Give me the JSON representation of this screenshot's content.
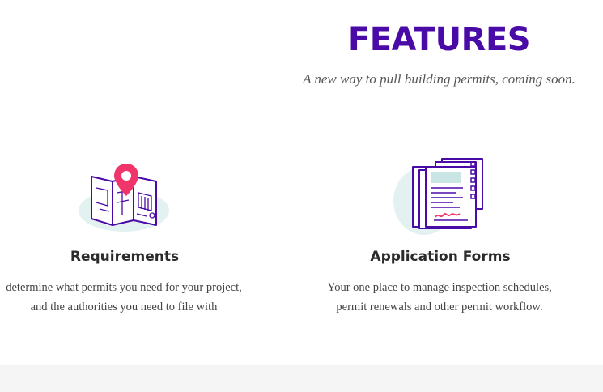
{
  "section": {
    "title": "FEATURES",
    "subtitle": "A new way to pull building permits, coming soon."
  },
  "features": [
    {
      "icon": "map-pin-icon",
      "title": "Requirements",
      "line1": "determine what permits you need for your project,",
      "line2": "and the authorities you need to file with"
    },
    {
      "icon": "documents-icon",
      "title": "Application Forms",
      "line1": "Your one place to manage inspection schedules,",
      "line2": "permit renewals and other permit workflow."
    }
  ],
  "colors": {
    "brand": "#4a0aa8",
    "pin": "#f0356b",
    "blob": "#e3f2f1",
    "heading": "#2b2b2b",
    "body_text": "#444444"
  }
}
